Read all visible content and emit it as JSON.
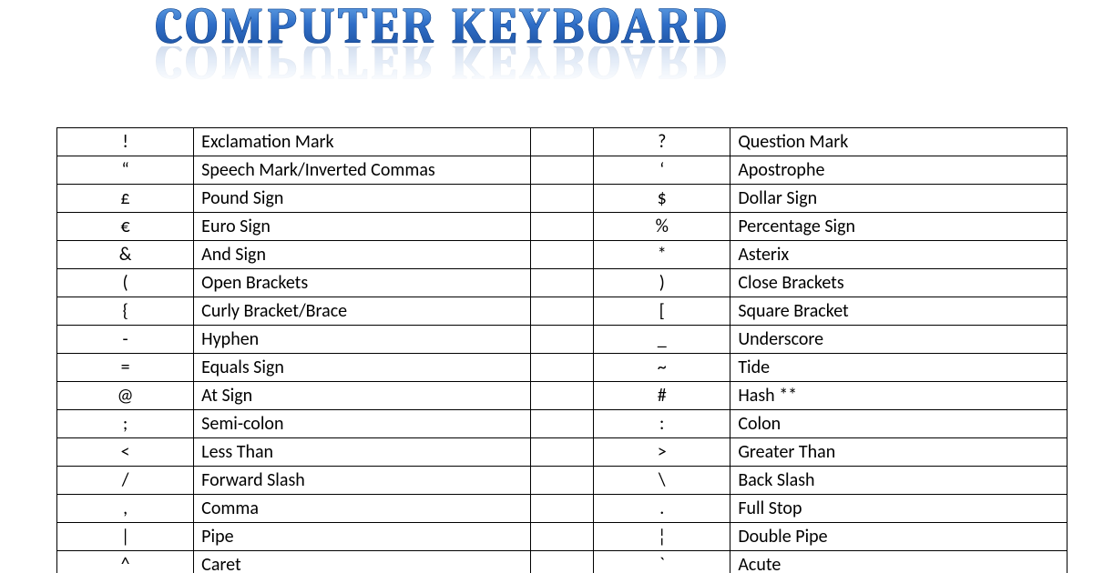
{
  "title": "COMPUTER KEYBOARD",
  "rows": [
    {
      "l_sym": "!",
      "l_name": "Exclamation Mark",
      "r_sym": "?",
      "r_name": "Question Mark"
    },
    {
      "l_sym": "“",
      "l_name": "Speech Mark/Inverted Commas",
      "r_sym": "‘",
      "r_name": "Apostrophe"
    },
    {
      "l_sym": "£",
      "l_name": "Pound Sign",
      "r_sym": "$",
      "r_name": "Dollar Sign"
    },
    {
      "l_sym": "€",
      "l_name": "Euro Sign",
      "r_sym": "%",
      "r_name": "Percentage Sign"
    },
    {
      "l_sym": "&",
      "l_name": "And Sign",
      "r_sym": "*",
      "r_name": "Asterix"
    },
    {
      "l_sym": "(",
      "l_name": "Open Brackets",
      "r_sym": ")",
      "r_name": "Close Brackets"
    },
    {
      "l_sym": "{",
      "l_name": "Curly Bracket/Brace",
      "r_sym": "[",
      "r_name": "Square Bracket"
    },
    {
      "l_sym": "-",
      "l_name": "Hyphen",
      "r_sym": "_",
      "r_name": "Underscore"
    },
    {
      "l_sym": "=",
      "l_name": "Equals Sign",
      "r_sym": "~",
      "r_name": "Tide"
    },
    {
      "l_sym": "@",
      "l_name": "At Sign",
      "r_sym": "#",
      "r_name": "Hash **"
    },
    {
      "l_sym": ";",
      "l_name": "Semi-colon",
      "r_sym": ":",
      "r_name": "Colon"
    },
    {
      "l_sym": "<",
      "l_name": "Less Than",
      "r_sym": ">",
      "r_name": "Greater Than"
    },
    {
      "l_sym": "/",
      "l_name": "Forward Slash",
      "r_sym": "\\",
      "r_name": "Back Slash"
    },
    {
      "l_sym": ",",
      "l_name": "Comma",
      "r_sym": ".",
      "r_name": "Full Stop"
    },
    {
      "l_sym": "|",
      "l_name": "Pipe",
      "r_sym": "¦",
      "r_name": "Double Pipe"
    },
    {
      "l_sym": "^",
      "l_name": "Caret",
      "r_sym": "`",
      "r_name": "Acute"
    }
  ]
}
